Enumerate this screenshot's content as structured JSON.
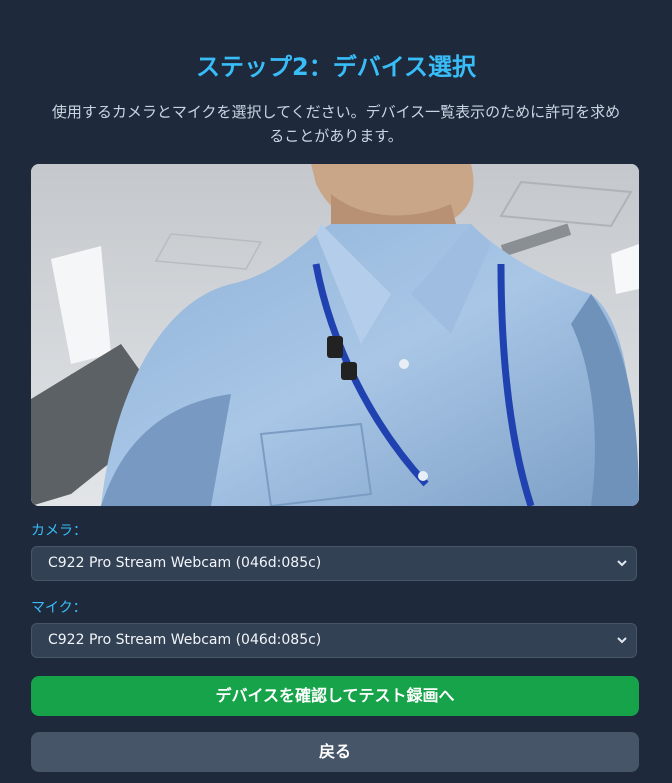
{
  "step": {
    "title": "ステップ2：デバイス選択",
    "description_line1": "使用するカメラとマイクを選択してください。デバイス一覧表示のために許可を求め",
    "description_line2": "ることがあります。"
  },
  "camera": {
    "label": "カメラ：",
    "selected": "C922 Pro Stream Webcam (046d:085c)"
  },
  "mic": {
    "label": "マイク：",
    "selected": "C922 Pro Stream Webcam (046d:085c)"
  },
  "actions": {
    "confirm_label": "デバイスを確認してテスト録画へ",
    "back_label": "戻る"
  },
  "colors": {
    "background": "#1e293b",
    "accent": "#38bdf8",
    "primary_button": "#16a34a",
    "secondary_button": "#475569"
  }
}
